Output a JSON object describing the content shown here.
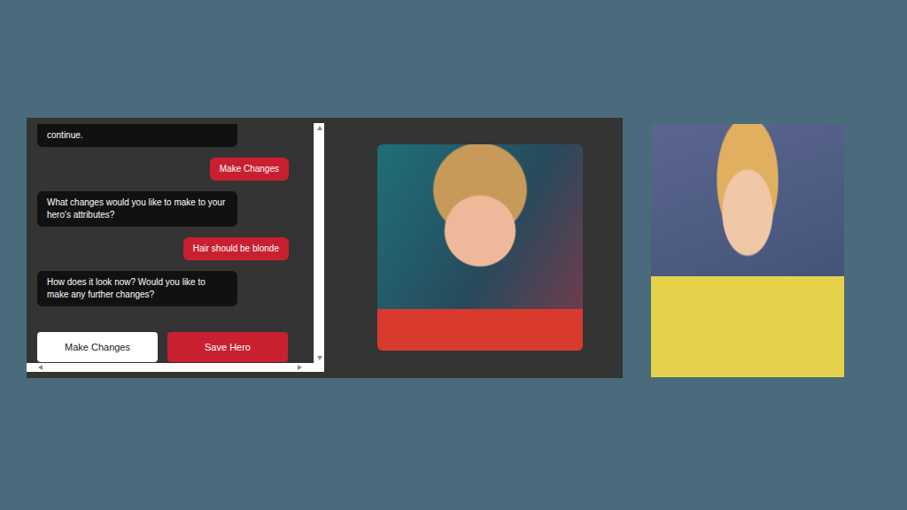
{
  "chat": {
    "messages": [
      {
        "kind": "bot",
        "text": "continue."
      },
      {
        "kind": "user",
        "text": "Make Changes"
      },
      {
        "kind": "bot",
        "text": "What changes would you like to make to your hero's attributes?"
      },
      {
        "kind": "user",
        "text": "Hair should be blonde"
      },
      {
        "kind": "bot",
        "text": "How does it look now? Would you like to make any further changes?"
      }
    ]
  },
  "buttons": [
    {
      "label": "Make Changes",
      "kind": "secondary"
    },
    {
      "label": "Save Hero",
      "kind": "primary"
    }
  ]
}
